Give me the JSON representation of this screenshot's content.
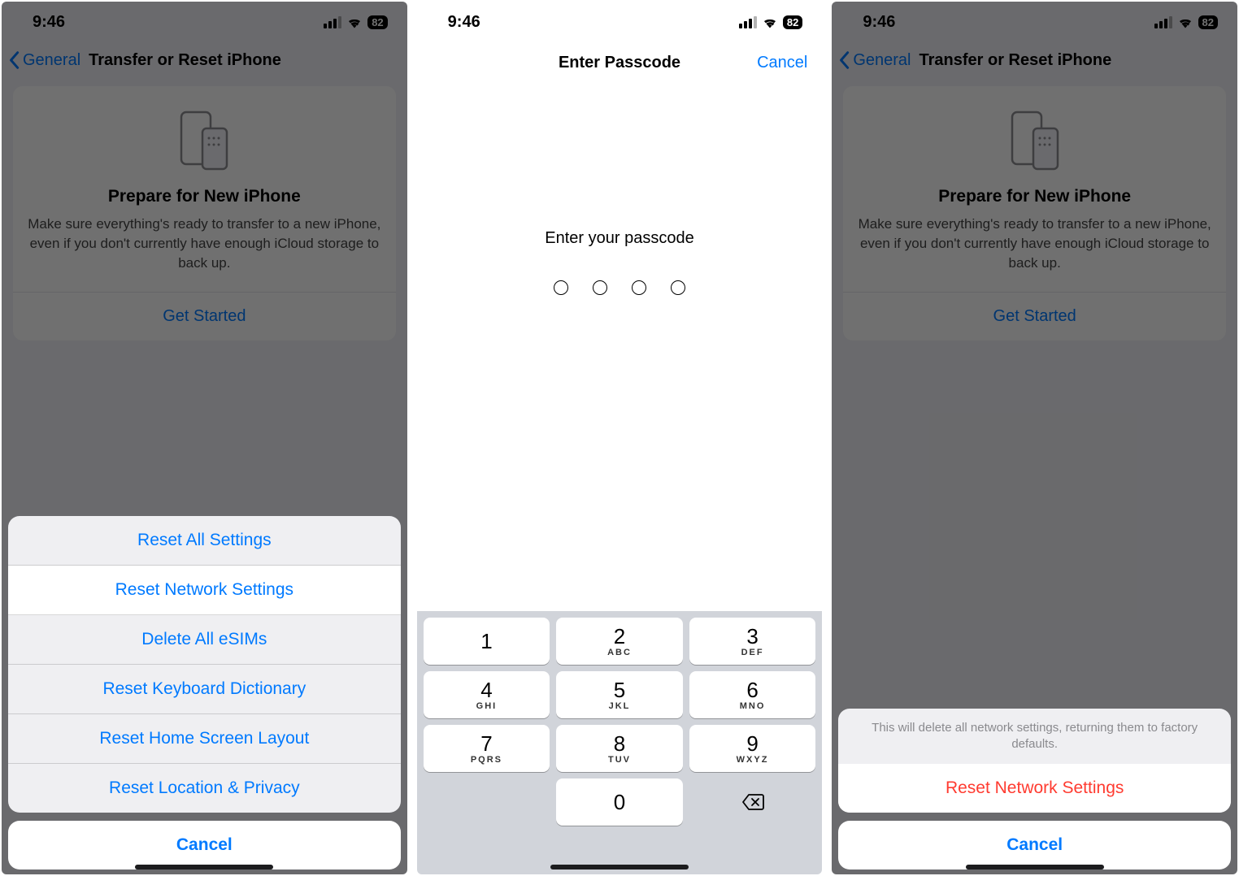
{
  "status": {
    "time": "9:46",
    "battery": "82"
  },
  "nav": {
    "back": "General",
    "title": "Transfer or Reset iPhone"
  },
  "card": {
    "title": "Prepare for New iPhone",
    "desc": "Make sure everything's ready to transfer to a new iPhone, even if you don't currently have enough iCloud storage to back up.",
    "cta": "Get Started"
  },
  "sheet1": {
    "items": [
      "Reset All Settings",
      "Reset Network Settings",
      "Delete All eSIMs",
      "Reset Keyboard Dictionary",
      "Reset Home Screen Layout",
      "Reset Location & Privacy"
    ],
    "cancel": "Cancel"
  },
  "passcode": {
    "title": "Enter Passcode",
    "cancel": "Cancel",
    "prompt": "Enter your passcode",
    "keys": [
      {
        "n": "1",
        "l": ""
      },
      {
        "n": "2",
        "l": "ABC"
      },
      {
        "n": "3",
        "l": "DEF"
      },
      {
        "n": "4",
        "l": "GHI"
      },
      {
        "n": "5",
        "l": "JKL"
      },
      {
        "n": "6",
        "l": "MNO"
      },
      {
        "n": "7",
        "l": "PQRS"
      },
      {
        "n": "8",
        "l": "TUV"
      },
      {
        "n": "9",
        "l": "WXYZ"
      },
      {
        "n": "",
        "l": ""
      },
      {
        "n": "0",
        "l": ""
      },
      {
        "n": "del",
        "l": ""
      }
    ]
  },
  "sheet3": {
    "note": "This will delete all network settings, returning them to factory defaults.",
    "confirm": "Reset Network Settings",
    "cancel": "Cancel"
  }
}
